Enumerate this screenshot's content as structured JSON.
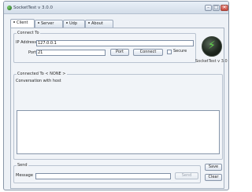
{
  "window": {
    "title": "SocketTest v 3.0.0",
    "controls": {
      "minimize": "–",
      "maximize": "□",
      "close": "✕"
    }
  },
  "tabs": [
    {
      "label": "Client",
      "active": true
    },
    {
      "label": "Server",
      "active": false
    },
    {
      "label": "Udp",
      "active": false
    },
    {
      "label": "About",
      "active": false
    }
  ],
  "connect": {
    "legend": "Connect To",
    "ip_label": "IP Address",
    "ip_value": "127.0.0.1",
    "port_label": "Port",
    "port_value": "21",
    "port_button": "Port",
    "connect_button": "Connect",
    "secure_label": "Secure",
    "secure_checked": false
  },
  "logo": {
    "text": "SocketTest v 3.0"
  },
  "connected": {
    "legend": "Connected To < NONE >",
    "conversation_label": "Conversation with host"
  },
  "send": {
    "legend": "Send",
    "message_label": "Message",
    "message_value": "",
    "send_button": "Send",
    "save_button": "Save",
    "clear_button": "Clear"
  },
  "colors": {
    "window_bg": "#edf1f6",
    "panel_bg": "#f1f4f8",
    "logo_accent": "#5fd34a"
  },
  "icons": {
    "app": "socket-app-icon",
    "logo": "socket-plug-logo-icon"
  }
}
